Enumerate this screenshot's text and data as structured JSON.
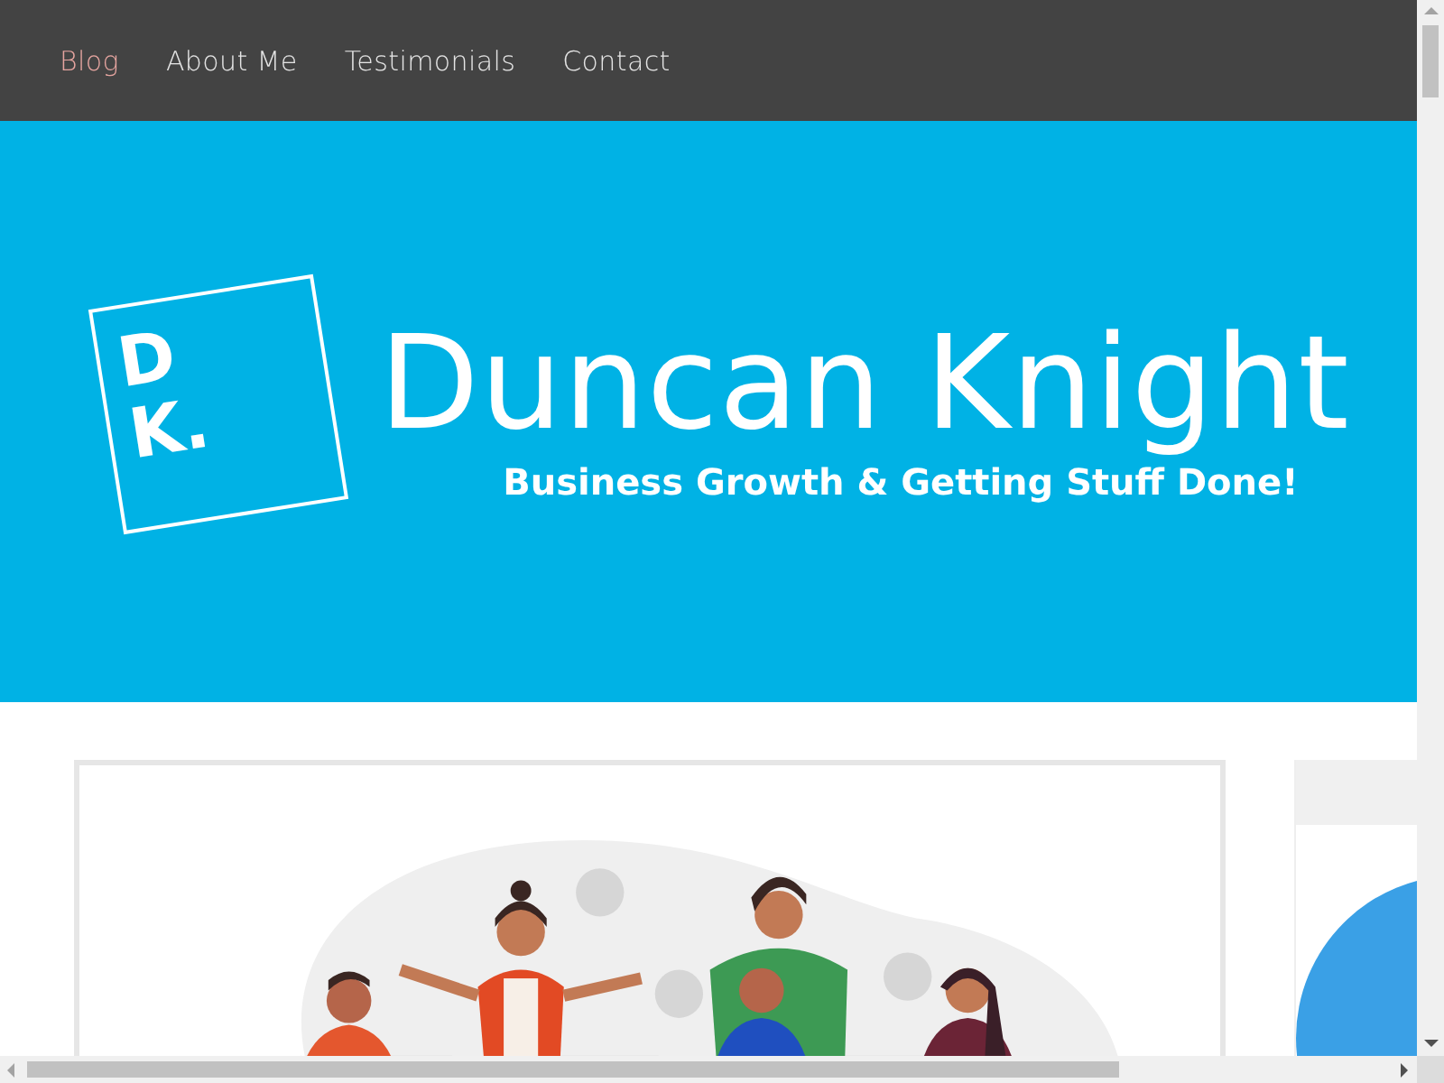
{
  "nav": [
    {
      "label": "Blog",
      "selected": true
    },
    {
      "label": "About Me",
      "selected": false
    },
    {
      "label": "Testimonials",
      "selected": false
    },
    {
      "label": "Contact",
      "selected": false
    }
  ],
  "logo": {
    "lines": [
      "D",
      "K."
    ]
  },
  "hero": {
    "title": "Duncan Knight",
    "subtitle": "Business Growth & Getting Stuff Done!"
  }
}
